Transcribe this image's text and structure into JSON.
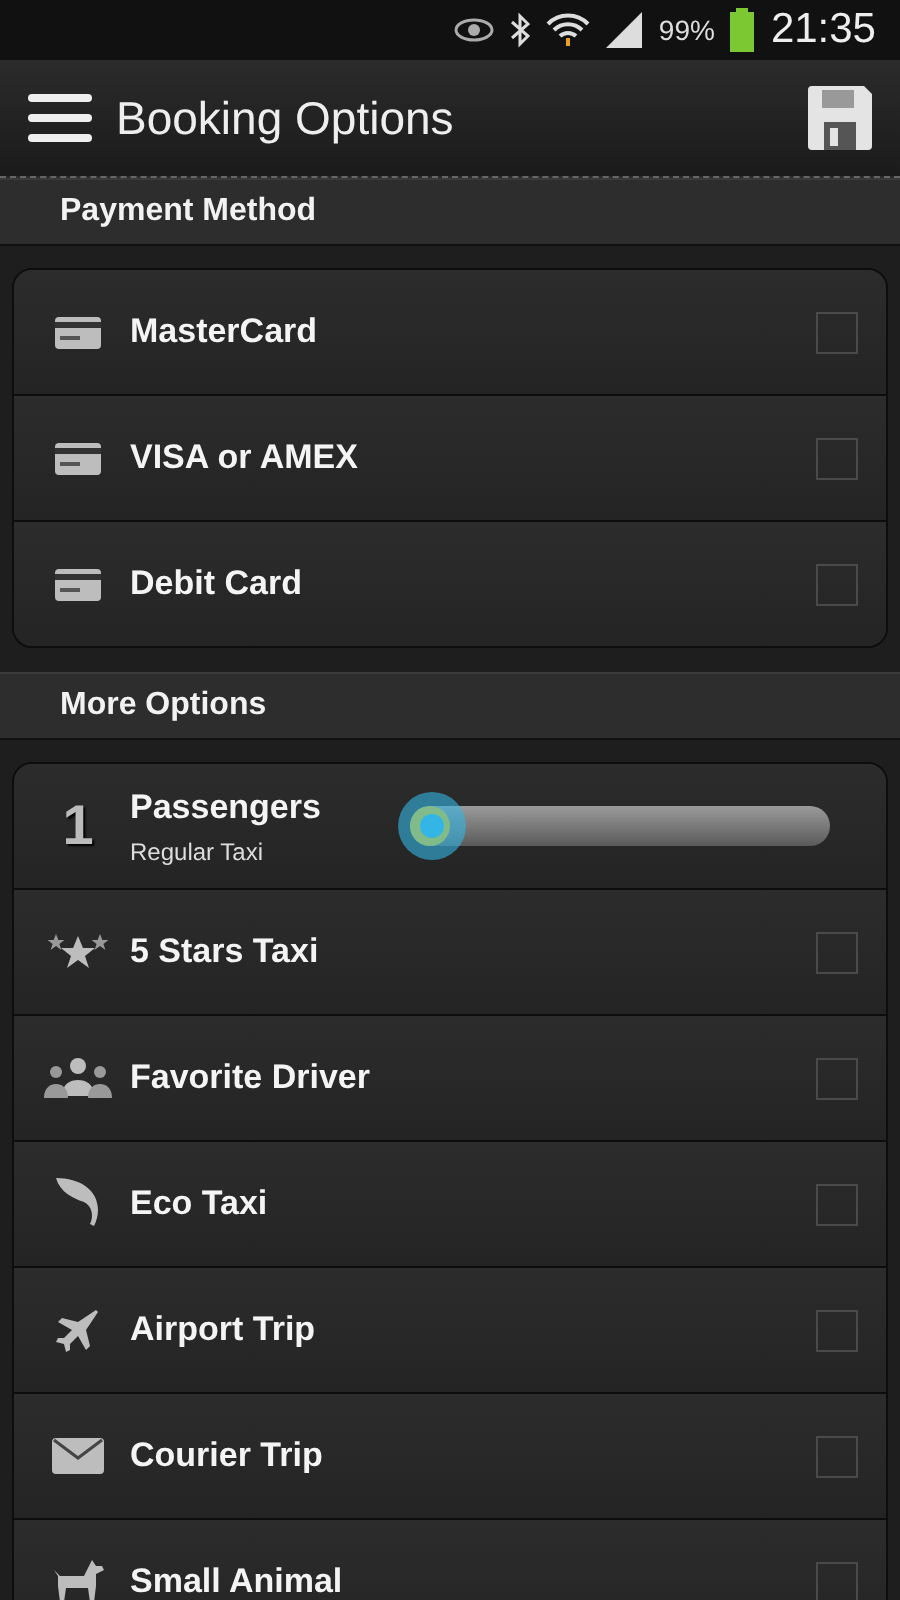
{
  "status_bar": {
    "battery": "99%",
    "time": "21:35"
  },
  "app_bar": {
    "title": "Booking Options"
  },
  "sections": [
    {
      "title": "Payment Method",
      "items": [
        {
          "kind": "checkbox",
          "label": "MasterCard",
          "checked": false
        },
        {
          "kind": "checkbox",
          "label": "VISA or AMEX",
          "checked": false
        },
        {
          "kind": "checkbox",
          "label": "Debit Card",
          "checked": false
        }
      ]
    },
    {
      "title": "More Options",
      "items": [
        {
          "kind": "slider",
          "value": "1",
          "label": "Passengers",
          "sublabel": "Regular Taxi",
          "level": 0
        },
        {
          "kind": "checkbox",
          "label": "5 Stars Taxi",
          "checked": false
        },
        {
          "kind": "checkbox",
          "label": "Favorite Driver",
          "checked": false
        },
        {
          "kind": "checkbox",
          "label": "Eco Taxi",
          "checked": false
        },
        {
          "kind": "checkbox",
          "label": "Airport Trip",
          "checked": false
        },
        {
          "kind": "checkbox",
          "label": "Courier Trip",
          "checked": false
        },
        {
          "kind": "checkbox",
          "label": "Small Animal",
          "checked": false
        }
      ]
    }
  ]
}
